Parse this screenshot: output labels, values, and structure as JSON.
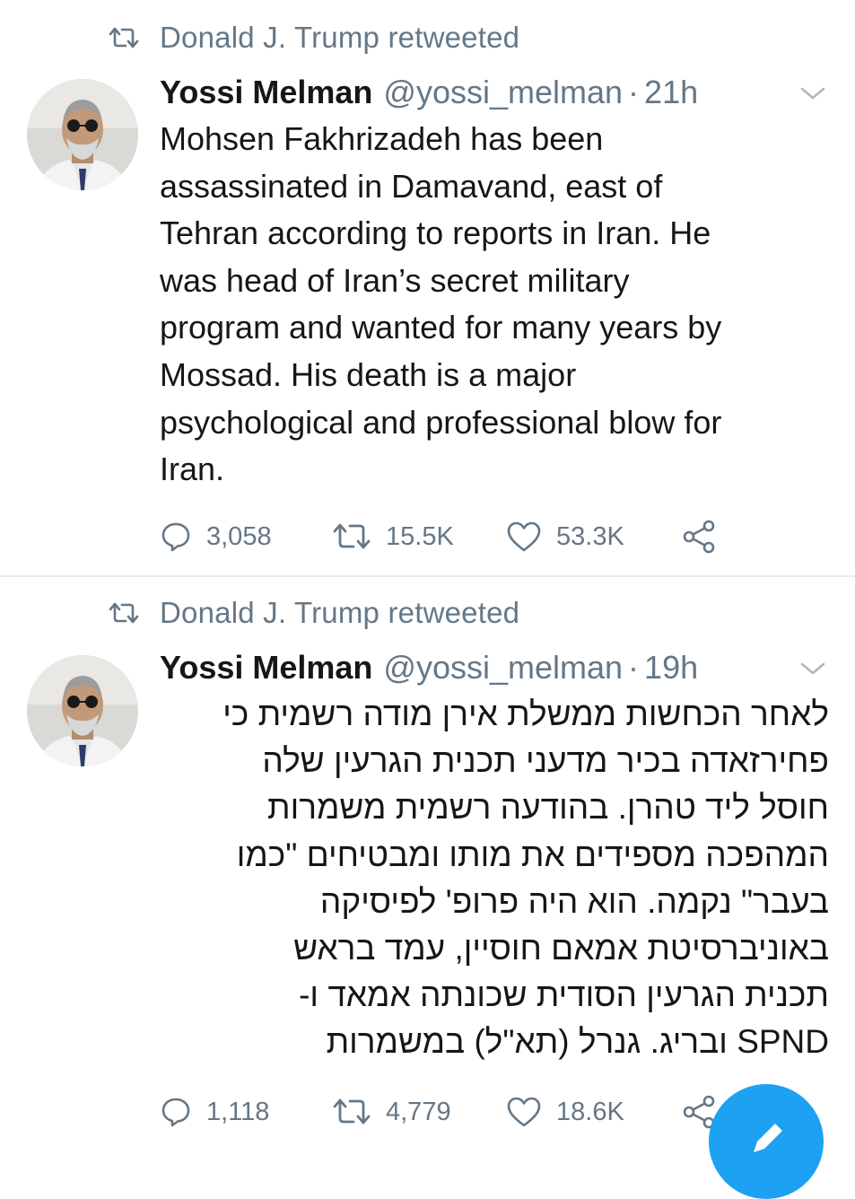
{
  "tweets": [
    {
      "retweet_context": "Donald J. Trump retweeted",
      "author_name": "Yossi Melman",
      "author_handle": "@yossi_melman",
      "separator": "·",
      "timestamp": "21h",
      "body": "Mohsen Fakhrizadeh has been\nassassinated in Damavand, east of\nTehran according to reports in Iran. He\nwas head of Iran’s secret military\nprogram and wanted for many years by\nMossad. His death is a major\npsychological and professional blow for\nIran.",
      "replies": "3,058",
      "retweets": "15.5K",
      "likes": "53.3K"
    },
    {
      "retweet_context": "Donald J. Trump retweeted",
      "author_name": "Yossi Melman",
      "author_handle": "@yossi_melman",
      "separator": "·",
      "timestamp": "19h",
      "body": "לאחר הכחשות ממשלת אירן מודה רשמית כי\nפחירזאדה בכיר מדעני תכנית הגרעין שלה\nחוסל ליד טהרן. בהודעה רשמית משמרות\nהמהפכה מספידים את מותו ומבטיחים \"כמו\nבעבר\" נקמה. הוא היה פרופ' לפיסיקה\nבאוניברסיטת אמאם חוסיין, עמד בראש\nתכנית הגרעין הסודית שכונתה אמאד ו-\nSPND ובריג. גנרל (תא\"ל) במשמרות",
      "replies": "1,118",
      "retweets": "4,779",
      "likes": "18.6K"
    }
  ],
  "icons": {
    "retweet": "retweet-icon",
    "reply": "reply-icon",
    "like": "heart-icon",
    "share": "share-icon",
    "caret": "chevron-down-icon",
    "compose": "compose-icon"
  },
  "colors": {
    "text_primary": "#14171a",
    "text_secondary": "#657786",
    "divider": "#e6ecf0",
    "accent": "#1da1f2"
  }
}
